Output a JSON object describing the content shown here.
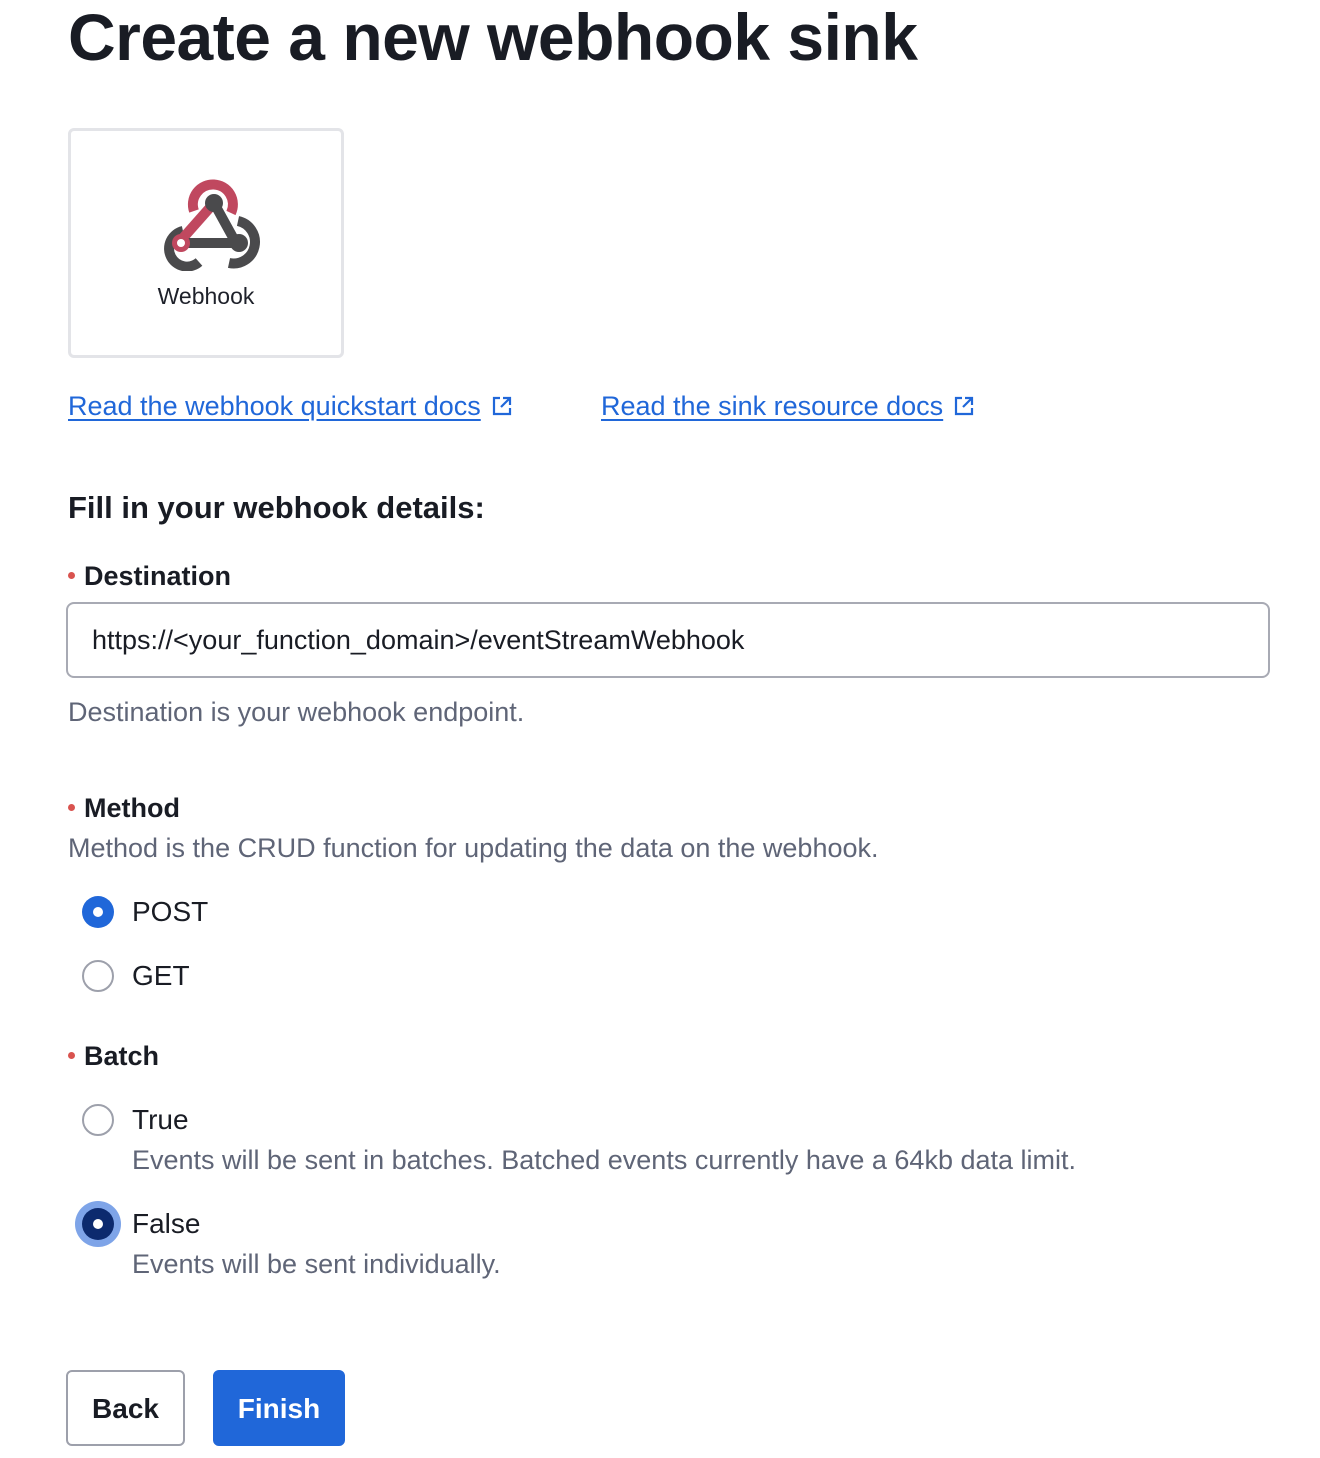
{
  "page": {
    "title": "Create a new webhook sink"
  },
  "sink_card": {
    "label": "Webhook",
    "icon": "webhook-logo-icon"
  },
  "links": {
    "quickstart": "Read the webhook quickstart docs",
    "resource": "Read the sink resource docs",
    "icon": "external-link-icon"
  },
  "form": {
    "heading": "Fill in your webhook details:",
    "destination": {
      "label": "Destination",
      "value": "https://<your_function_domain>/eventStreamWebhook",
      "help": "Destination is your webhook endpoint."
    },
    "method": {
      "label": "Method",
      "help": "Method is the CRUD function for updating the data on the webhook.",
      "options": [
        {
          "label": "POST",
          "checked": true
        },
        {
          "label": "GET",
          "checked": false
        }
      ]
    },
    "batch": {
      "label": "Batch",
      "options": [
        {
          "label": "True",
          "description": "Events will be sent in batches. Batched events currently have a 64kb data limit.",
          "checked": false
        },
        {
          "label": "False",
          "description": "Events will be sent individually.",
          "checked": true,
          "focused": true
        }
      ]
    }
  },
  "actions": {
    "back": "Back",
    "finish": "Finish"
  },
  "colors": {
    "primary": "#2067d9",
    "required": "#d9534f",
    "logo_red": "#c0485f",
    "logo_gray": "#4a4a4c"
  }
}
